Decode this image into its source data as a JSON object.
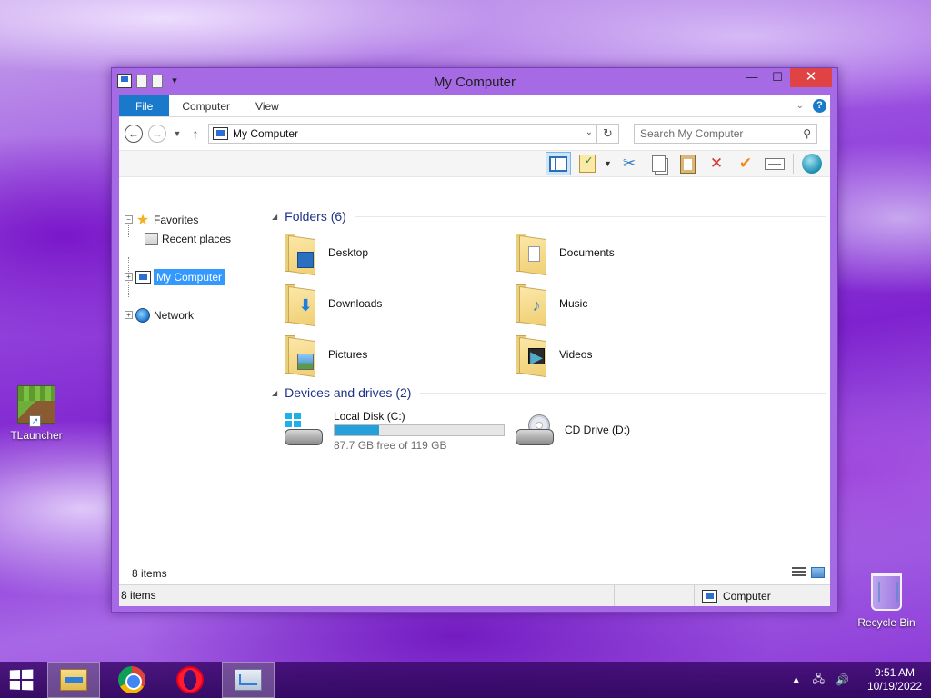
{
  "desktop": {
    "icons": [
      {
        "label": "TLauncher"
      },
      {
        "label": "Recycle Bin"
      }
    ]
  },
  "window": {
    "title": "My Computer",
    "controls": {
      "minimize": "—",
      "maximize": "☐",
      "close": "✕"
    },
    "ribbon": {
      "tabs": [
        "File",
        "Computer",
        "View"
      ],
      "help": "?"
    },
    "nav": {
      "address": "My Computer",
      "search_placeholder": "Search My Computer"
    },
    "tree": {
      "favorites": "Favorites",
      "recent": "Recent places",
      "computer": "My Computer",
      "network": "Network"
    },
    "groups": {
      "folders_header": "Folders (6)",
      "devices_header": "Devices and drives (2)"
    },
    "folders": [
      {
        "name": "Desktop",
        "icon": "desktop-folder-icon"
      },
      {
        "name": "Documents",
        "icon": "documents-folder-icon"
      },
      {
        "name": "Downloads",
        "icon": "downloads-folder-icon"
      },
      {
        "name": "Music",
        "icon": "music-folder-icon"
      },
      {
        "name": "Pictures",
        "icon": "pictures-folder-icon"
      },
      {
        "name": "Videos",
        "icon": "videos-folder-icon"
      }
    ],
    "drives": [
      {
        "name": "Local Disk (C:)",
        "free_text": "87.7 GB free of 119 GB",
        "used_fraction": 0.263
      },
      {
        "name": "CD Drive (D:)"
      }
    ],
    "status": {
      "item_count": "8 items",
      "statusbar_count": "8 items",
      "location": "Computer"
    }
  },
  "taskbar": {
    "apps": [
      "File Explorer",
      "Google Chrome",
      "Opera",
      "Resource Monitor"
    ],
    "time": "9:51 AM",
    "date": "10/19/2022"
  },
  "colors": {
    "accent": "#1979ca",
    "selection": "#3399ff",
    "window_frame": "#a56ae4",
    "close": "#e04343",
    "drive_bar": "#26a0da"
  }
}
